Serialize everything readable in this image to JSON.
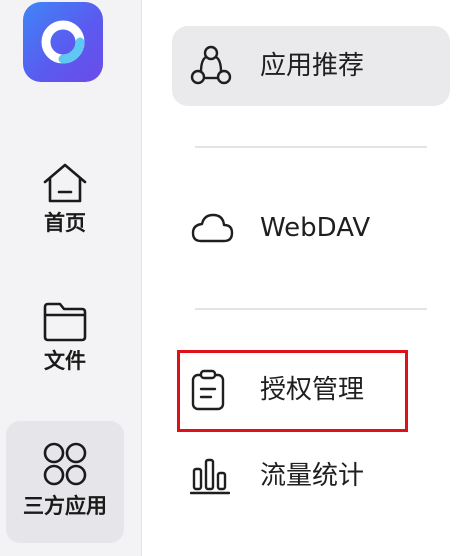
{
  "sidebar": {
    "logo_icon": "app-logo-icon",
    "items": [
      {
        "label": "首页",
        "icon": "home-icon"
      },
      {
        "label": "文件",
        "icon": "folder-icon"
      },
      {
        "label": "三方应用",
        "icon": "apps-grid-icon",
        "selected": true
      }
    ]
  },
  "menu": {
    "items": [
      {
        "label": "应用推荐",
        "icon": "share-nodes-icon",
        "selected": true
      },
      {
        "label": "WebDAV",
        "icon": "cloud-icon"
      },
      {
        "label": "授权管理",
        "icon": "clipboard-icon",
        "highlighted": true
      },
      {
        "label": "流量统计",
        "icon": "bar-chart-icon"
      }
    ]
  },
  "colors": {
    "accent_gradient": [
      "#3f86f6",
      "#6c4be8"
    ],
    "highlight_border": "#e0101a",
    "selected_bg": "#eaeaec"
  }
}
